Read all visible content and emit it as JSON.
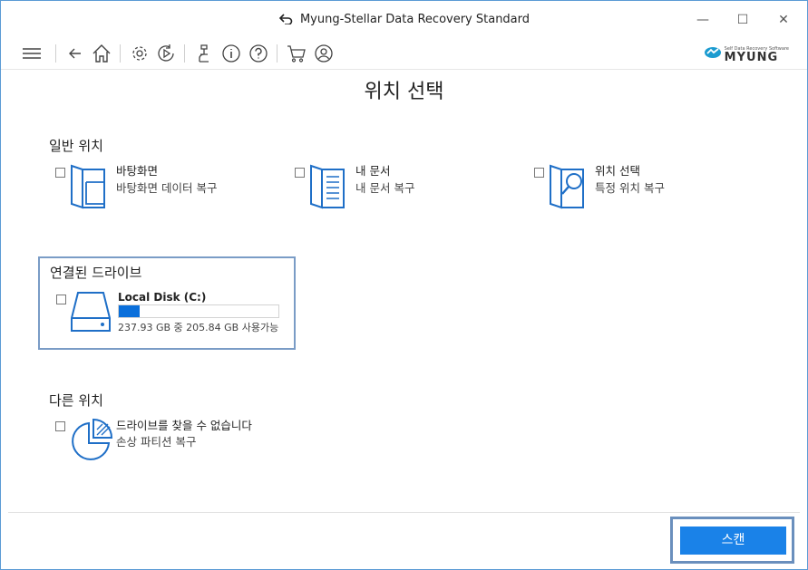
{
  "window": {
    "title": "Myung-Stellar Data Recovery Standard",
    "minimize": "—",
    "maximize": "☐",
    "close": "✕"
  },
  "toolbar": {
    "icons": [
      "menu-icon",
      "back-icon",
      "home-icon",
      "settings-icon",
      "resume-icon",
      "scan-engine-icon",
      "info-icon",
      "help-icon",
      "cart-icon",
      "account-icon"
    ],
    "logo_tagline": "Self Data Recovery Software",
    "logo_name": "MYUNG"
  },
  "page": {
    "title": "위치 선택"
  },
  "common_locations": {
    "heading": "일반 위치",
    "items": [
      {
        "name": "바탕화면",
        "description": "바탕화면 데이터 복구",
        "checked": false,
        "icon": "desktop-folder-icon"
      },
      {
        "name": "내 문서",
        "description": "내 문서 복구",
        "checked": false,
        "icon": "documents-folder-icon"
      },
      {
        "name": "위치 선택",
        "description": "특정 위치 복구",
        "checked": false,
        "icon": "folder-search-icon"
      }
    ]
  },
  "connected_drives": {
    "heading": "연결된 드라이브",
    "drives": [
      {
        "name": "Local Disk (C:)",
        "usage": "237.93 GB 중 205.84 GB 사용가능",
        "used_fraction": 0.13,
        "checked": false,
        "icon": "hard-drive-icon"
      }
    ]
  },
  "other_locations": {
    "heading": "다른 위치",
    "items": [
      {
        "name": "드라이브를 찾을 수 없습니다",
        "description": "손상 파티션 복구",
        "checked": false,
        "icon": "partition-pie-icon"
      }
    ]
  },
  "actions": {
    "scan_label": "스캔"
  },
  "colors": {
    "accent": "#1a82e8",
    "icon_blue": "#1f6fc7",
    "frame_border": "#7a9cc6",
    "window_border": "#5b9bd5"
  }
}
